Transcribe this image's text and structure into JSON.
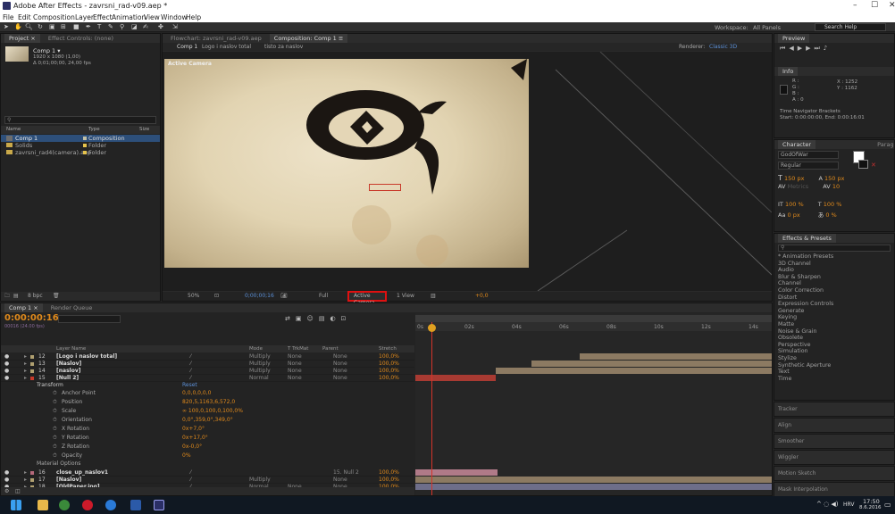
{
  "window": {
    "title": "Adobe After Effects - zavrsni_rad-v09.aep *",
    "minimize": "–",
    "maximize": "☐",
    "close": "✕"
  },
  "menu": [
    "File",
    "Edit",
    "Composition",
    "Layer",
    "Effect",
    "Animation",
    "View",
    "Window",
    "Help"
  ],
  "toolbar": {
    "workspace_label": "Workspace:",
    "workspace_value": "All Panels",
    "search_placeholder": "Search Help"
  },
  "project": {
    "tabs": [
      "Project ×",
      "Effect Controls: (none)"
    ],
    "comp_name": "Comp 1 ▾",
    "comp_info1": "1920 x 1080 (1,00)",
    "comp_info2": "Δ 0;01;00;00, 24,00 fps",
    "columns": {
      "name": "Name",
      "type": "Type",
      "size": "Size"
    },
    "items": [
      {
        "name": "Comp 1",
        "type": "Composition",
        "selected": true
      },
      {
        "name": "Solids",
        "type": "Folder",
        "selected": false
      },
      {
        "name": "zavrsni_rad4(camera).aep",
        "type": "Folder",
        "selected": false
      }
    ],
    "bpc": "8 bpc"
  },
  "viewer": {
    "tabs": [
      "Flowchart: zavrsni_rad-v09.aep",
      "Composition: Comp 1 ≡"
    ],
    "breadcrumbs": [
      "Comp 1",
      "Logo i naslov total",
      "tisto za naslov"
    ],
    "renderer_label": "Renderer:",
    "renderer_value": "Classic 3D",
    "overlay_label": "Active Camera",
    "zoom": "50%",
    "timecode": "0;00;00;16",
    "resolution": "Full",
    "camera": "Active Camera",
    "views": "1 View",
    "exposure": "+0,0"
  },
  "timeline": {
    "tabs": [
      "Comp 1 ×",
      "Render Queue"
    ],
    "timecode": "0:00:00:16",
    "fps_sub": "00016 (24.00 fps)",
    "headers": {
      "layer_name": "Layer Name",
      "mode": "Mode",
      "trkmat": "T TrkMat",
      "parent": "Parent",
      "stretch": "Stretch"
    },
    "layers": [
      {
        "num": "12",
        "name": "[Logo i naslov total]",
        "mode": "Multiply",
        "trk": "None",
        "parent": "None",
        "stretch": "100,0%"
      },
      {
        "num": "13",
        "name": "[Naslov]",
        "mode": "Multiply",
        "trk": "None",
        "parent": "None",
        "stretch": "100,0%"
      },
      {
        "num": "14",
        "name": "[naslov]",
        "mode": "Multiply",
        "trk": "None",
        "parent": "None",
        "stretch": "100,0%"
      },
      {
        "num": "15",
        "name": "[Null 2]",
        "mode": "Normal",
        "trk": "None",
        "parent": "None",
        "stretch": "100,0%"
      }
    ],
    "transform_label": "Transform",
    "reset_label": "Reset",
    "props": [
      {
        "name": "Anchor Point",
        "value": "0,0,0,0,0,0"
      },
      {
        "name": "Position",
        "value": "820,5,1163,6,572,0"
      },
      {
        "name": "Scale",
        "value": "∞ 100,0,100,0,100,0%"
      },
      {
        "name": "Orientation",
        "value": "0,0°,359,0°,349,0°"
      },
      {
        "name": "X Rotation",
        "value": "0x+7,0°"
      },
      {
        "name": "Y Rotation",
        "value": "0x+17,0°"
      },
      {
        "name": "Z Rotation",
        "value": "0x-0,0°"
      },
      {
        "name": "Opacity",
        "value": "0%"
      }
    ],
    "material_label": "Material Options",
    "layers2": [
      {
        "num": "16",
        "name": "close_up_naslov1",
        "mode": "",
        "trk": "",
        "parent": "15. Null 2",
        "stretch": "100,0%"
      },
      {
        "num": "17",
        "name": "[Naslov]",
        "mode": "Multiply",
        "trk": "",
        "parent": "None",
        "stretch": "100,0%"
      },
      {
        "num": "18",
        "name": "[OldPaper.jpg]",
        "mode": "Normal",
        "trk": "None",
        "parent": "None",
        "stretch": "100,0%"
      }
    ],
    "ruler": [
      "0s",
      "02s",
      "04s",
      "06s",
      "08s",
      "10s",
      "12s",
      "14s"
    ]
  },
  "info": {
    "tabs": [
      "Preview",
      "Info"
    ],
    "r": "R :",
    "g": "G :",
    "b": "B :",
    "a": "A : 0",
    "x": "X : 1252",
    "y": "Y : 1162",
    "nav_title": "Time Navigator Brackets",
    "nav_value": "Start: 0:00:00:00, End: 0:00:16:01"
  },
  "character": {
    "tabs": [
      "Character",
      "Paragraph"
    ],
    "font": "GodOfWar",
    "style": "Regular",
    "size": "150 px",
    "leading": "150 px",
    "metrics": "Metrics",
    "tracking": "10",
    "scale_v": "100 %",
    "scale_h": "100 %",
    "baseline": "0 px",
    "tsume": "0 %"
  },
  "effects": {
    "title": "Effects & Presets",
    "items": [
      "* Animation Presets",
      "3D Channel",
      "Audio",
      "Blur & Sharpen",
      "Channel",
      "Color Correction",
      "Distort",
      "Expression Controls",
      "Generate",
      "Keying",
      "Matte",
      "Noise & Grain",
      "Obsolete",
      "Perspective",
      "Simulation",
      "Stylize",
      "Synthetic Aperture",
      "Text",
      "Time"
    ]
  },
  "side_panels": [
    "Tracker",
    "Align",
    "Smoother",
    "Wiggler",
    "Motion Sketch",
    "Mask Interpolation"
  ],
  "taskbar": {
    "lang": "HRV",
    "time": "17:50",
    "date": "8.6.2016"
  },
  "colors": {
    "accent": "#e08a1c",
    "selection": "#2d4f7a",
    "highlight_box": "#e01010"
  }
}
